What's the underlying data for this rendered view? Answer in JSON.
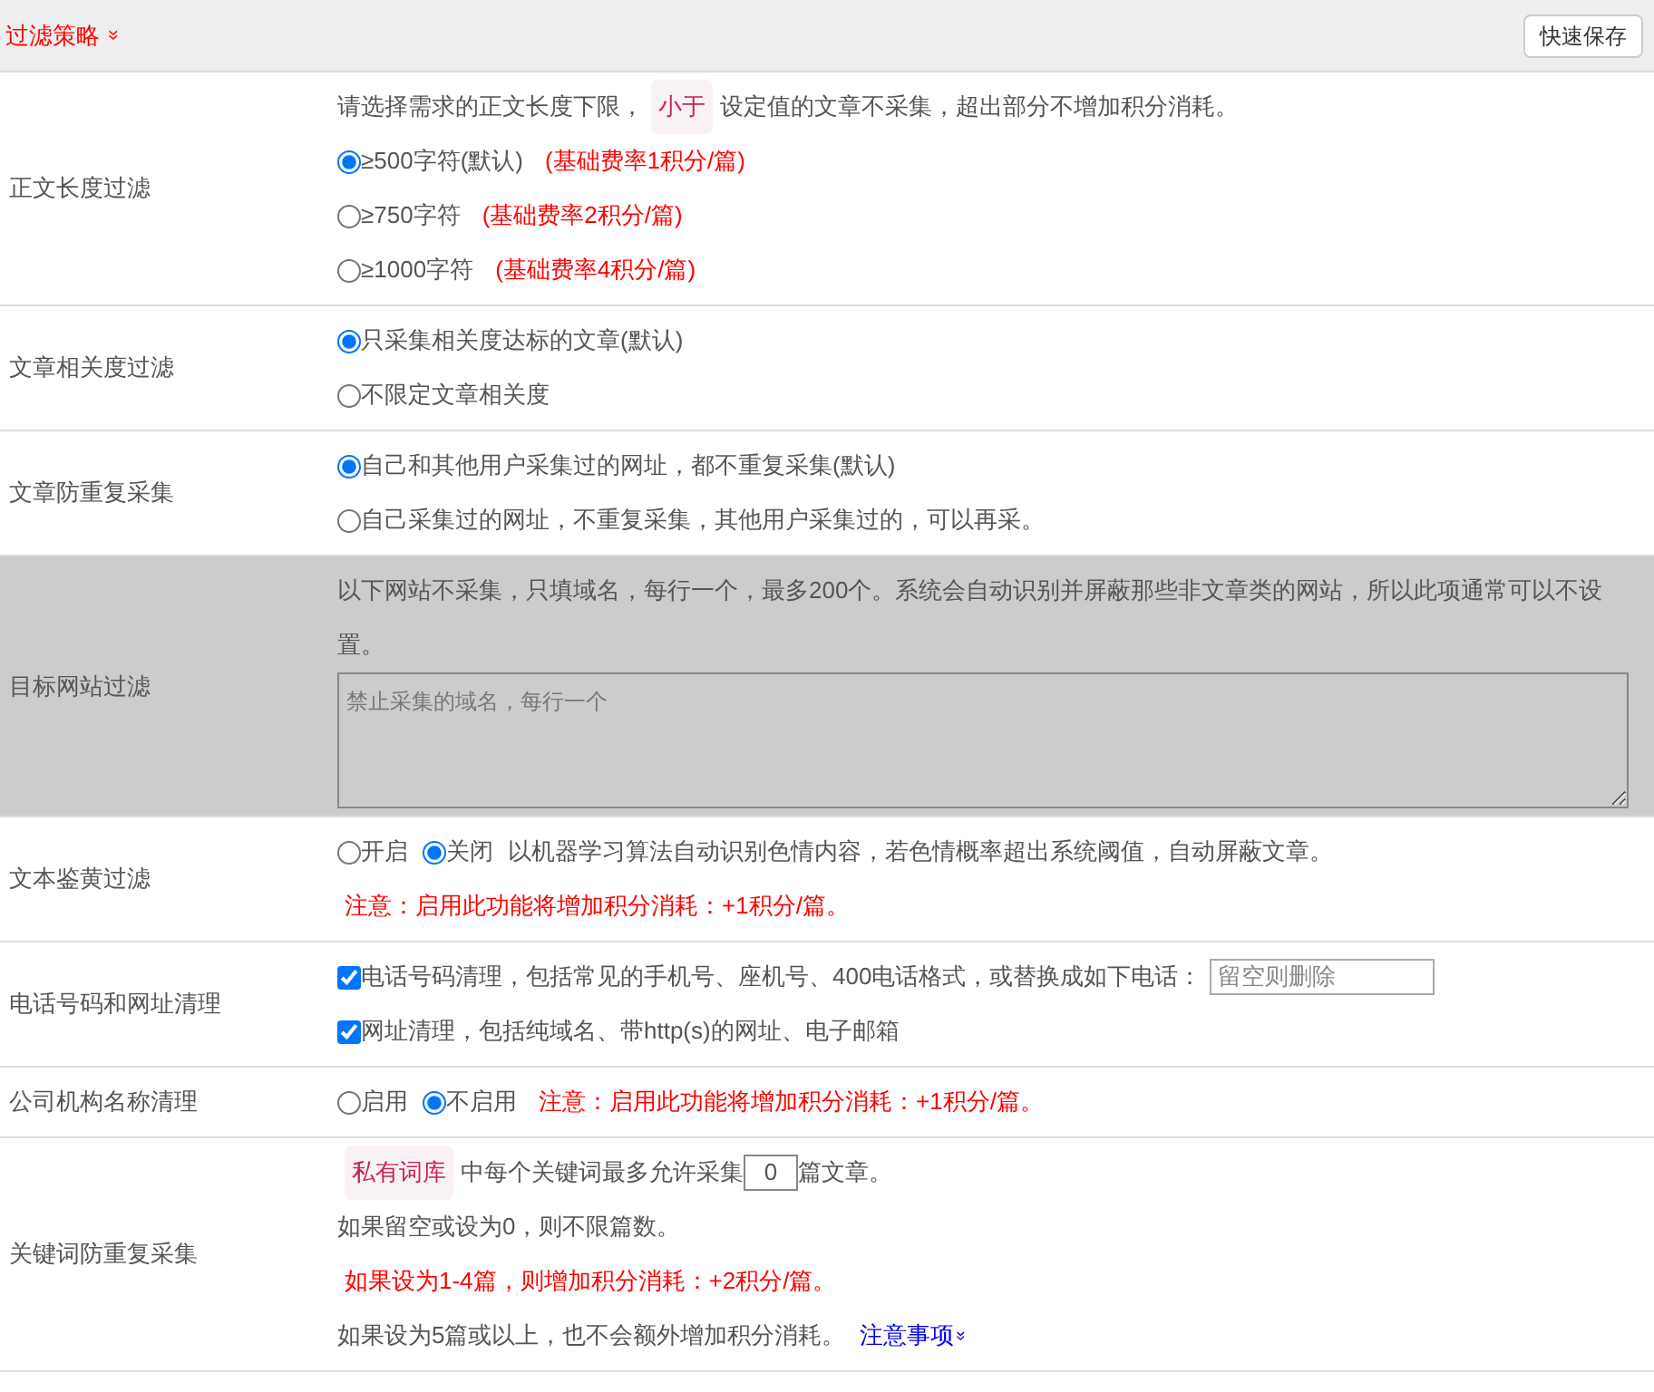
{
  "header": {
    "title": "过滤策略",
    "expand_icon": "»",
    "save_button": "快速保存"
  },
  "rows": [
    {
      "label": "正文长度过滤",
      "shaded": false,
      "lines": [
        [
          {
            "kind": "text",
            "text": "请选择需求的正文长度下限，"
          },
          {
            "kind": "tag",
            "text": "小于"
          },
          {
            "kind": "text",
            "text": "设定值的文章不采集，超出部分不增加积分消耗。"
          }
        ],
        [
          {
            "kind": "radio",
            "text": "≥500字符(默认)",
            "selected": true
          },
          {
            "kind": "note",
            "text": "(基础费率1积分/篇)"
          }
        ],
        [
          {
            "kind": "radio",
            "text": "≥750字符",
            "selected": false
          },
          {
            "kind": "note",
            "text": "(基础费率2积分/篇)"
          }
        ],
        [
          {
            "kind": "radio",
            "text": "≥1000字符",
            "selected": false
          },
          {
            "kind": "note",
            "text": "(基础费率4积分/篇)"
          }
        ]
      ]
    },
    {
      "label": "文章相关度过滤",
      "shaded": false,
      "lines": [
        [
          {
            "kind": "radio",
            "text": "只采集相关度达标的文章(默认)",
            "selected": true
          }
        ],
        [
          {
            "kind": "radio",
            "text": "不限定文章相关度",
            "selected": false
          }
        ]
      ]
    },
    {
      "label": "文章防重复采集",
      "shaded": false,
      "lines": [
        [
          {
            "kind": "radio",
            "text": "自己和其他用户采集过的网址，都不重复采集(默认)",
            "selected": true
          }
        ],
        [
          {
            "kind": "radio",
            "text": "自己采集过的网址，不重复采集，其他用户采集过的，可以再采。",
            "selected": false
          }
        ]
      ]
    },
    {
      "label": "目标网站过滤",
      "shaded": true,
      "lines": [
        [
          {
            "kind": "text",
            "text": "以下网站不采集，只填域名，每行一个，最多200个。系统会自动识别并屏蔽那些非文章类的网站，所以此项通常可以不设置。"
          }
        ],
        [
          {
            "kind": "textarea",
            "placeholder": "禁止采集的域名，每行一个"
          }
        ]
      ]
    },
    {
      "label": "文本鉴黄过滤",
      "shaded": false,
      "lines": [
        [
          {
            "kind": "radio",
            "text": "开启",
            "selected": false
          },
          {
            "kind": "radio",
            "text": "关闭",
            "selected": true
          },
          {
            "kind": "text",
            "text": "以机器学习算法自动识别色情内容，若色情概率超出系统阈值，自动屏蔽文章。"
          }
        ],
        [
          {
            "kind": "note",
            "text": "注意：启用此功能将增加积分消耗：+1积分/篇。"
          }
        ]
      ]
    },
    {
      "label": "电话号码和网址清理",
      "shaded": false,
      "lines": [
        [
          {
            "kind": "checkbox",
            "text": "电话号码清理，包括常见的手机号、座机号、400电话格式，或替换成如下电话：",
            "checked": true
          },
          {
            "kind": "input",
            "placeholder": "留空则删除"
          }
        ],
        [
          {
            "kind": "checkbox",
            "text": "网址清理，包括纯域名、带http(s)的网址、电子邮箱",
            "checked": true
          }
        ]
      ]
    },
    {
      "label": "公司机构名称清理",
      "shaded": false,
      "lines": [
        [
          {
            "kind": "radio",
            "text": "启用",
            "selected": false
          },
          {
            "kind": "radio",
            "text": "不启用",
            "selected": true
          },
          {
            "kind": "note",
            "text": "注意：启用此功能将增加积分消耗：+1积分/篇。"
          }
        ]
      ]
    },
    {
      "label": "关键词防重复采集",
      "shaded": false,
      "lines": [
        [
          {
            "kind": "tag",
            "text": "私有词库"
          },
          {
            "kind": "text",
            "text": "中每个关键词最多允许采集"
          },
          {
            "kind": "number",
            "value": "0"
          },
          {
            "kind": "text",
            "text": "篇文章。"
          }
        ],
        [
          {
            "kind": "text",
            "text": "如果留空或设为0，则不限篇数。"
          }
        ],
        [
          {
            "kind": "note",
            "text": "如果设为1-4篇，则增加积分消耗：+2积分/篇。"
          }
        ],
        [
          {
            "kind": "text",
            "text": "如果设为5篇或以上，也不会额外增加积分消耗。"
          },
          {
            "kind": "link",
            "text": "注意事项",
            "icon": "»"
          }
        ]
      ]
    }
  ]
}
